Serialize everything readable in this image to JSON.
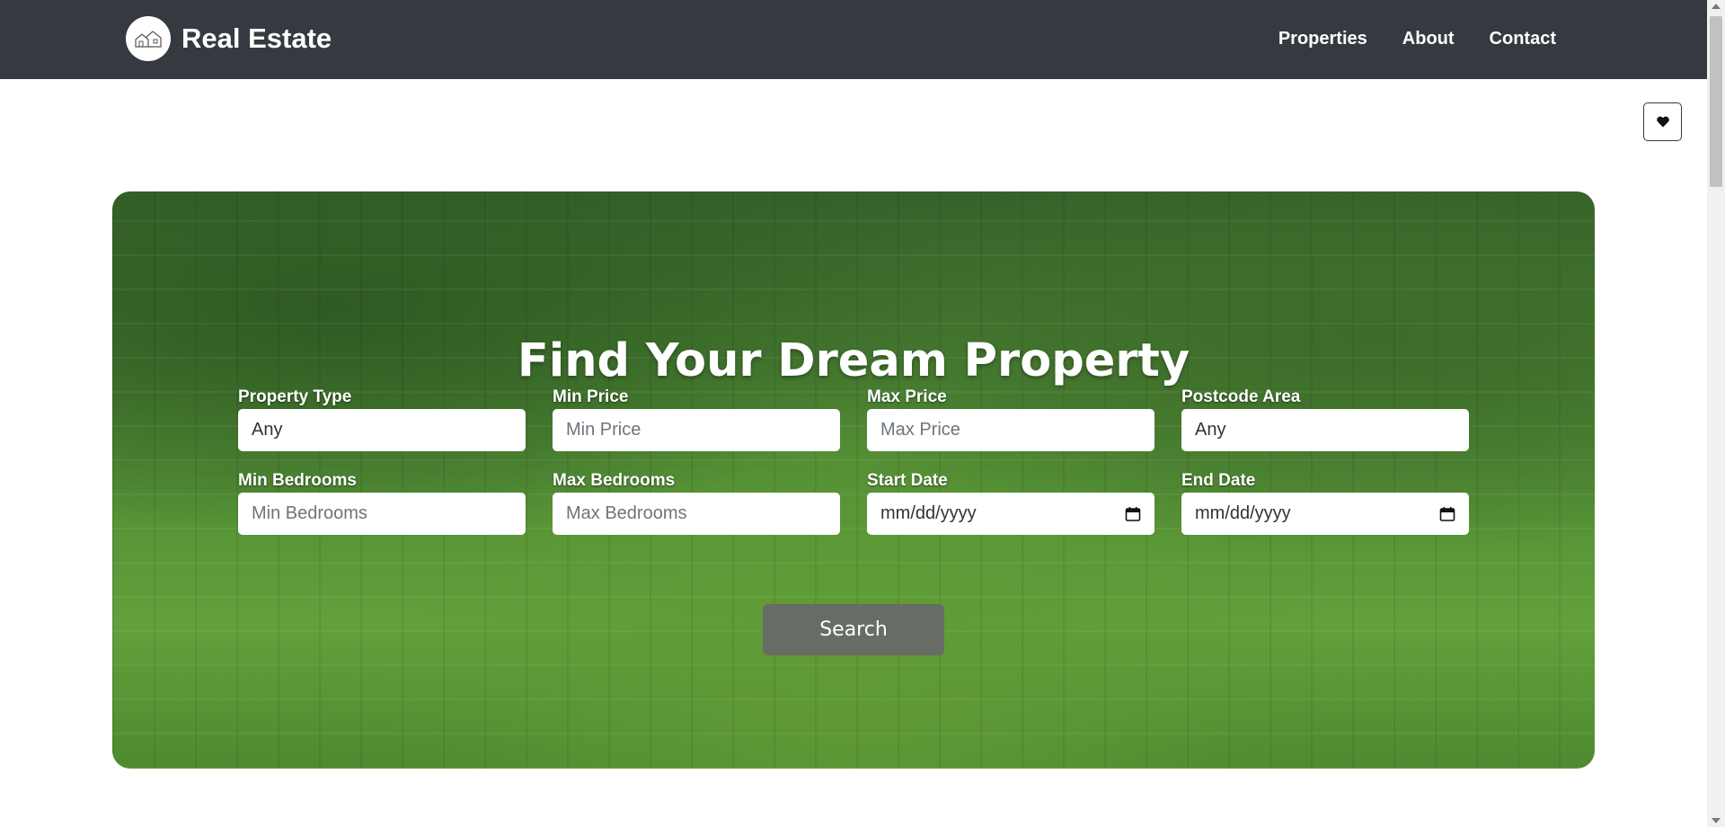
{
  "header": {
    "brand_name": "Real Estate",
    "logo_icon": "house-logo-icon",
    "nav": [
      "Properties",
      "About",
      "Contact"
    ]
  },
  "favorites": {
    "icon": "heart-icon"
  },
  "hero": {
    "title": "Find Your Dream Property",
    "fields": {
      "property_type": {
        "label": "Property Type",
        "value": "Any"
      },
      "min_price": {
        "label": "Min Price",
        "placeholder": "Min Price"
      },
      "max_price": {
        "label": "Max Price",
        "placeholder": "Max Price"
      },
      "postcode_area": {
        "label": "Postcode Area",
        "value": "Any"
      },
      "min_bedrooms": {
        "label": "Min Bedrooms",
        "placeholder": "Min Bedrooms"
      },
      "max_bedrooms": {
        "label": "Max Bedrooms",
        "placeholder": "Max Bedrooms"
      },
      "start_date": {
        "label": "Start Date",
        "placeholder": "mm/dd/yyyy"
      },
      "end_date": {
        "label": "End Date",
        "placeholder": "mm/dd/yyyy"
      }
    },
    "search_label": "Search"
  },
  "colors": {
    "navbar": "#343a40",
    "search_button": "#676d66",
    "text_on_dark": "#ffffff"
  }
}
